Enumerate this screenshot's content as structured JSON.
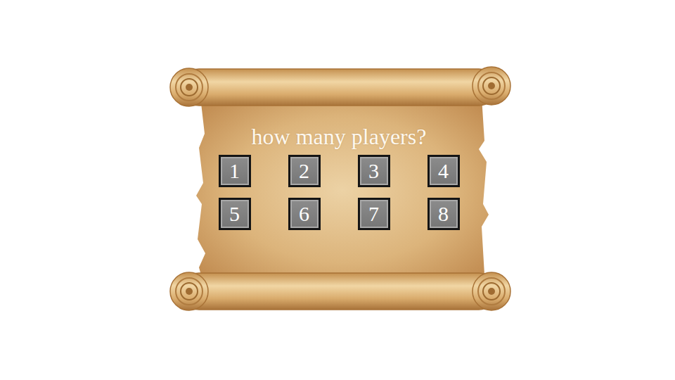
{
  "prompt": {
    "title": "how many players?"
  },
  "options": [
    {
      "label": "1"
    },
    {
      "label": "2"
    },
    {
      "label": "3"
    },
    {
      "label": "4"
    },
    {
      "label": "5"
    },
    {
      "label": "6"
    },
    {
      "label": "7"
    },
    {
      "label": "8"
    }
  ]
}
